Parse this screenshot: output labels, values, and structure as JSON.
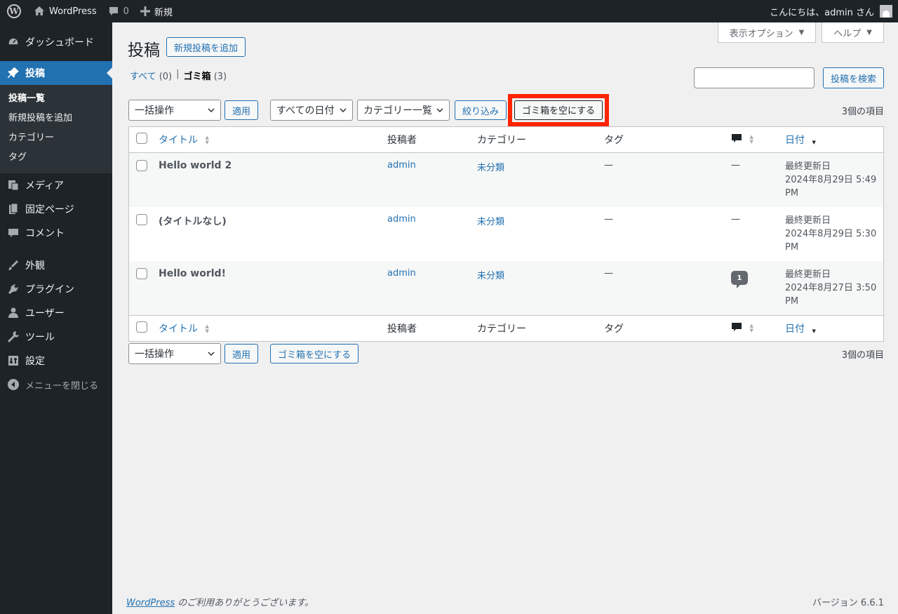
{
  "adminbar": {
    "site_name": "WordPress",
    "comments_count": "0",
    "new_label": "新規",
    "greeting": "こんにちは、admin さん"
  },
  "sidebar": {
    "items": [
      {
        "label": "ダッシュボード",
        "icon": "dashboard-icon"
      },
      {
        "label": "投稿",
        "icon": "pin-icon",
        "current": true
      },
      {
        "label": "メディア",
        "icon": "media-icon"
      },
      {
        "label": "固定ページ",
        "icon": "page-icon"
      },
      {
        "label": "コメント",
        "icon": "comment-icon"
      },
      {
        "label": "外観",
        "icon": "appearance-icon"
      },
      {
        "label": "プラグイン",
        "icon": "plugin-icon"
      },
      {
        "label": "ユーザー",
        "icon": "user-icon"
      },
      {
        "label": "ツール",
        "icon": "tools-icon"
      },
      {
        "label": "設定",
        "icon": "settings-icon"
      }
    ],
    "submenu": [
      "投稿一覧",
      "新規投稿を追加",
      "カテゴリー",
      "タグ"
    ],
    "collapse_label": "メニューを閉じる"
  },
  "screen_options": {
    "label": "表示オプション",
    "help": "ヘルプ"
  },
  "page": {
    "title": "投稿",
    "add_new": "新規投稿を追加",
    "views": {
      "all": "すべて",
      "all_count": "(0)",
      "separator": "|",
      "trash": "ゴミ箱",
      "trash_count": "(3)"
    },
    "search_button": "投稿を検索"
  },
  "tablenav_top": {
    "bulk_action": "一括操作",
    "apply": "適用",
    "date_filter": "すべての日付",
    "category_filter": "カテゴリー一覧",
    "filter_button": "絞り込み",
    "empty_trash": "ゴミ箱を空にする",
    "item_count": "3個の項目"
  },
  "tablenav_bottom": {
    "bulk_action": "一括操作",
    "apply": "適用",
    "empty_trash": "ゴミ箱を空にする",
    "item_count": "3個の項目"
  },
  "table": {
    "columns": {
      "title": "タイトル",
      "author": "投稿者",
      "categories": "カテゴリー",
      "tags": "タグ",
      "date": "日付"
    },
    "rows": [
      {
        "title": "Hello world 2",
        "author": "admin",
        "category": "未分類",
        "tags": "—",
        "comments": "—",
        "date_label": "最終更新日",
        "date": "2024年8月29日 5:49 PM"
      },
      {
        "title": "(タイトルなし)",
        "author": "admin",
        "category": "未分類",
        "tags": "—",
        "comments": "—",
        "date_label": "最終更新日",
        "date": "2024年8月29日 5:30 PM"
      },
      {
        "title": "Hello world!",
        "author": "admin",
        "category": "未分類",
        "tags": "—",
        "comments": "1",
        "date_label": "最終更新日",
        "date": "2024年8月27日 3:50 PM"
      }
    ]
  },
  "footer": {
    "brand": "WordPress",
    "thanks": " のご利用ありがとうございます。",
    "version": "バージョン 6.6.1"
  }
}
